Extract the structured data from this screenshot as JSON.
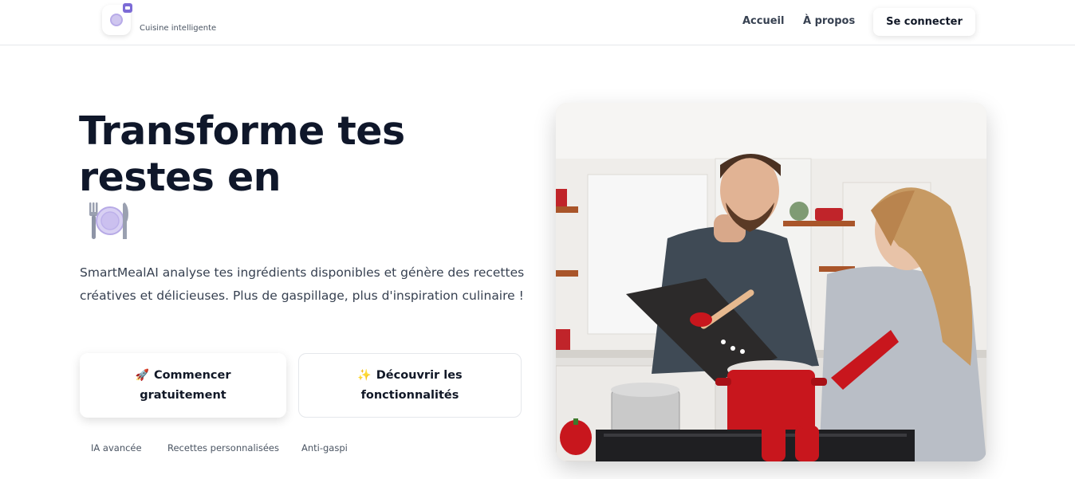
{
  "header": {
    "tagline": "Cuisine intelligente",
    "nav": {
      "home": "Accueil",
      "about": "À propos"
    },
    "login_label": "Se connecter"
  },
  "hero": {
    "title": "Transforme tes restes en",
    "title_icon": "fork-knife-plate-icon",
    "description": "SmartMealAI analyse tes ingrédients disponibles et génère des recettes créatives et délicieuses. Plus de gaspillage, plus d'inspiration culinaire !",
    "cta_primary": {
      "icon": "🚀",
      "line1": "Commencer",
      "line2": "gratuitement"
    },
    "cta_secondary": {
      "icon": "✨",
      "line1": "Découvrir les",
      "line2": "fonctionnalités"
    },
    "features": [
      "IA avancée",
      "Recettes personnalisées",
      "Anti-gaspi"
    ]
  },
  "colors": {
    "title": "#0f172a",
    "text": "#374151",
    "accent_purple": "#7c6bd6",
    "pot_red": "#c8161d"
  }
}
